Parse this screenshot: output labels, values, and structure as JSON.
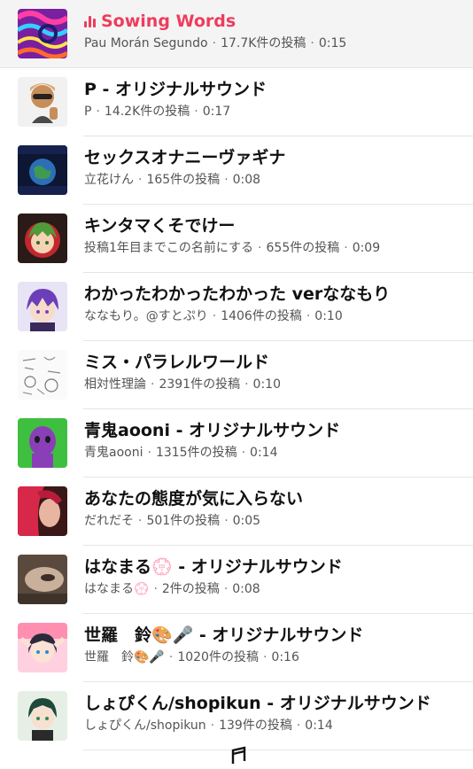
{
  "sounds": [
    {
      "title": "Sowing Words",
      "author": "Pau Morán Segundo",
      "posts": "17.7K件の投稿",
      "duration": "0:15",
      "playing": true,
      "thumb_icon": "psychedelic-swirl-art"
    },
    {
      "title": "P - オリジナルサウンド",
      "author": "P",
      "posts": "14.2K件の投稿",
      "duration": "0:17",
      "thumb_icon": "memoji-thumbs-down-avatar"
    },
    {
      "title": "セックスオナニーヴァギナ",
      "author": "立花けん",
      "posts": "165件の投稿",
      "duration": "0:08",
      "thumb_icon": "album-cover-earth"
    },
    {
      "title": "キンタマくそでけー",
      "author": "投稿1年目までこの名前にする",
      "posts": "655件の投稿",
      "duration": "0:09",
      "thumb_icon": "anime-green-hair-avatar"
    },
    {
      "title": "わかったわかったわかった verななもり",
      "author": "ななもり。@すとぷり",
      "posts": "1406件の投稿",
      "duration": "0:10",
      "thumb_icon": "anime-purple-hair-avatar"
    },
    {
      "title": "ミス・パラレルワールド",
      "author": "相対性理論",
      "posts": "2391件の投稿",
      "duration": "0:10",
      "thumb_icon": "sketch-drawing-thumbnail"
    },
    {
      "title": "青鬼aooni - オリジナルサウンド",
      "author": "青鬼aooni",
      "posts": "1315件の投稿",
      "duration": "0:14",
      "thumb_icon": "purple-monster-avatar"
    },
    {
      "title": "あなたの態度が気に入らない",
      "author": "だれだそ",
      "posts": "501件の投稿",
      "duration": "0:05",
      "thumb_icon": "red-hair-photo"
    },
    {
      "title": "はなまる💮 - オリジナルサウンド",
      "author": "はなまる💮",
      "posts": "2件の投稿",
      "duration": "0:08",
      "thumb_icon": "blurry-photo"
    },
    {
      "title": "世羅　鈴🎨🎤 - オリジナルサウンド",
      "author": "世羅　鈴🎨🎤",
      "posts": "1020件の投稿",
      "duration": "0:16",
      "thumb_icon": "anime-girl-avatar"
    },
    {
      "title": "しょぴくん/shopikun - オリジナルサウンド",
      "author": "しょぴくん/shopikun",
      "posts": "139件の投稿",
      "duration": "0:14",
      "thumb_icon": "anime-dark-green-hair-avatar"
    }
  ],
  "separator": "·",
  "footer_icon": "music-note-icon",
  "colors": {
    "accent": "#ef3c5c",
    "title": "#111111",
    "meta": "#545454",
    "active_bg": "#f4f4f5"
  }
}
